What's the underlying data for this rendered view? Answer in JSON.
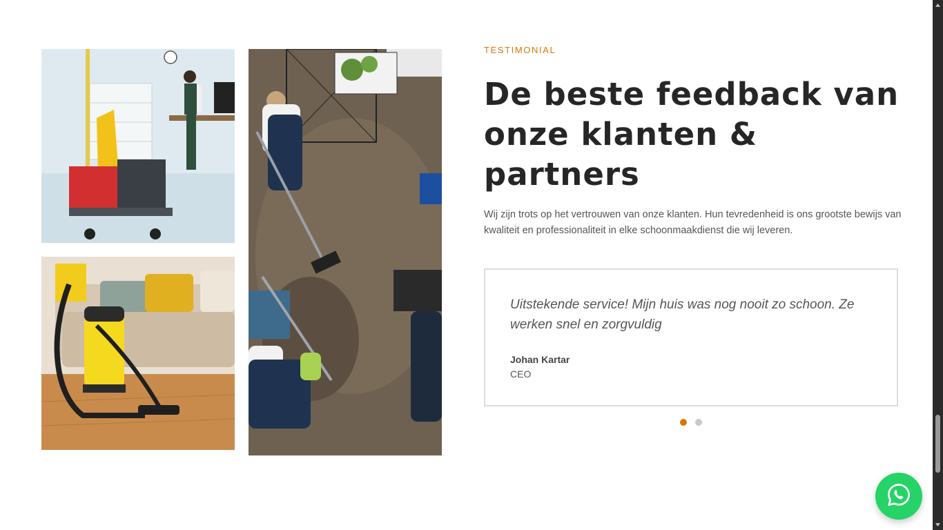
{
  "section": {
    "eyebrow": "TESTIMONIAL",
    "headline": "De beste feedback van onze klanten & partners",
    "lead": "Wij zijn trots op het vertrouwen van onze klanten. Hun tevredenheid is ons grootste bewijs van kwaliteit en professionaliteit in elke schoonmaakdienst die wij leveren."
  },
  "testimonial": {
    "quote": "Uitstekende service! Mijn huis was nog nooit zo schoon. Ze werken snel en zorgvuldig",
    "author": "Johan Kartar",
    "role": "CEO"
  },
  "carousel": {
    "slides": 2,
    "active_index": 0
  },
  "icons": {
    "whatsapp": "whatsapp-icon"
  },
  "colors": {
    "accent": "#d97706",
    "heading": "#262626",
    "whatsapp": "#25d366"
  }
}
